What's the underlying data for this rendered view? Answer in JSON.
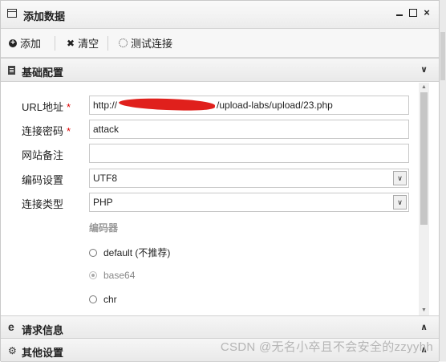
{
  "window": {
    "title": "添加数据",
    "icon": "window-icon",
    "controls": [
      "minimize-icon",
      "maximize-icon",
      "close-icon"
    ]
  },
  "toolbar": {
    "add_label": "添加",
    "clear_label": "清空",
    "test_label": "测试连接"
  },
  "sections": {
    "basic": {
      "title": "基础配置",
      "chevron": "chevron-down-icon"
    },
    "request": {
      "title": "请求信息",
      "chevron": "chevron-up-icon"
    },
    "other": {
      "title": "其他设置",
      "chevron": "chevron-up-icon"
    }
  },
  "form": {
    "url": {
      "label": "URL地址",
      "required": "*",
      "value": "http://                /upload-labs/upload/23.php",
      "value_prefix": "http://",
      "value_suffix": "/upload-labs/upload/23.php"
    },
    "password": {
      "label": "连接密码",
      "required": "*",
      "value": "attack"
    },
    "note": {
      "label": "网站备注",
      "value": ""
    },
    "encoding": {
      "label": "编码设置",
      "value": "UTF8"
    },
    "type": {
      "label": "连接类型",
      "value": "PHP"
    }
  },
  "encoder": {
    "title": "编码器",
    "options": [
      {
        "label": "default (不推荐)",
        "checked": false,
        "disabled": false
      },
      {
        "label": "base64",
        "checked": true,
        "disabled": true
      },
      {
        "label": "chr",
        "checked": false,
        "disabled": false
      }
    ]
  },
  "watermark": "CSDN @无名小卒且不会安全的zzyyhh",
  "colors": {
    "required": "#dd0000",
    "redaction": "#e0201c",
    "muted": "#999999"
  }
}
